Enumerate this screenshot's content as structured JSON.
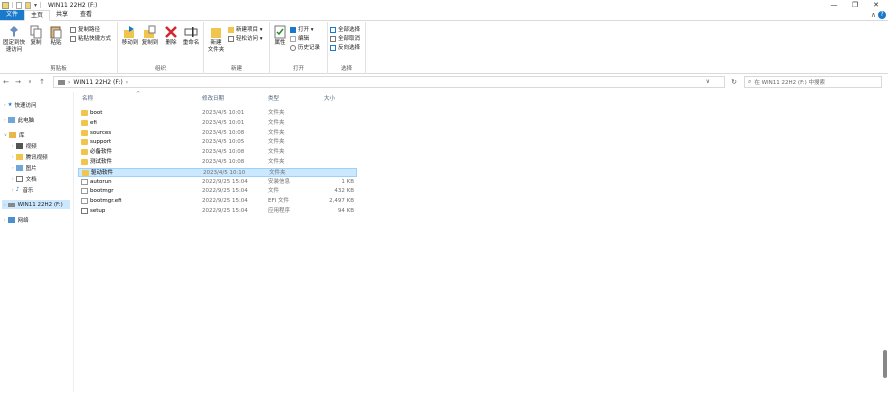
{
  "window": {
    "title": "WIN11 22H2 (F:)",
    "minimize": "—",
    "maximize": "❐",
    "close": "✕"
  },
  "ribbon_tabs": [
    "文件",
    "主页",
    "共享",
    "查看"
  ],
  "ribbon": {
    "clipboard": {
      "label": "剪贴板",
      "pin": "固定到快速访问",
      "copy": "复制",
      "paste": "粘贴",
      "copy_path": "复制路径",
      "paste_shortcut": "粘贴快捷方式"
    },
    "organize": {
      "label": "组织",
      "move_to": "移动到",
      "copy_to": "复制到",
      "delete": "删除",
      "rename": "重命名"
    },
    "new": {
      "label": "新建",
      "new_folder": "新建\n文件夹",
      "new_item": "新建项目 ▾",
      "easy_access": "轻松访问 ▾"
    },
    "open": {
      "label": "打开",
      "properties": "属性",
      "open": "打开 ▾",
      "edit": "编辑",
      "history": "历史记录"
    },
    "select": {
      "label": "选择",
      "select_all": "全部选择",
      "select_none": "全部取消",
      "invert": "反向选择"
    }
  },
  "address": {
    "path": "WIN11 22H2 (F:)",
    "search_placeholder": "在 WIN11 22H2 (F:) 中搜索"
  },
  "nav": {
    "back": "←",
    "forward": "→",
    "recent": "∨",
    "up": "↑",
    "refresh": "↻"
  },
  "navpane": [
    {
      "label": "快速访问",
      "icon": "star-icon"
    },
    {
      "label": "此电脑",
      "icon": "computer-icon"
    },
    {
      "label": "库",
      "icon": "library-icon"
    },
    {
      "label": "视频",
      "icon": "video-icon"
    },
    {
      "label": "腾讯视频",
      "icon": "folder-icon"
    },
    {
      "label": "图片",
      "icon": "picture-icon"
    },
    {
      "label": "文档",
      "icon": "document-icon"
    },
    {
      "label": "音乐",
      "icon": "music-icon"
    },
    {
      "label": "WIN11 22H2 (F:)",
      "icon": "drive-icon"
    },
    {
      "label": "网络",
      "icon": "network-icon"
    }
  ],
  "columns": {
    "name": "名称",
    "date": "修改日期",
    "type": "类型",
    "size": "大小"
  },
  "files": [
    {
      "name": "boot",
      "date": "2023/4/5 10:01",
      "type": "文件夹",
      "size": "",
      "kind": "folder"
    },
    {
      "name": "efi",
      "date": "2023/4/5 10:01",
      "type": "文件夹",
      "size": "",
      "kind": "folder"
    },
    {
      "name": "sources",
      "date": "2023/4/5 10:08",
      "type": "文件夹",
      "size": "",
      "kind": "folder"
    },
    {
      "name": "support",
      "date": "2023/4/5 10:05",
      "type": "文件夹",
      "size": "",
      "kind": "folder"
    },
    {
      "name": "必备软件",
      "date": "2023/4/5 10:08",
      "type": "文件夹",
      "size": "",
      "kind": "folder"
    },
    {
      "name": "测试软件",
      "date": "2023/4/5 10:08",
      "type": "文件夹",
      "size": "",
      "kind": "folder"
    },
    {
      "name": "驱动软件",
      "date": "2023/4/5 10:10",
      "type": "文件夹",
      "size": "",
      "kind": "folder"
    },
    {
      "name": "autorun",
      "date": "2022/9/25 15:04",
      "type": "安装信息",
      "size": "1 KB",
      "kind": "doc"
    },
    {
      "name": "bootmgr",
      "date": "2022/9/25 15:04",
      "type": "文件",
      "size": "432 KB",
      "kind": "doc"
    },
    {
      "name": "bootmgr.efi",
      "date": "2022/9/25 15:04",
      "type": "EFI 文件",
      "size": "2,497 KB",
      "kind": "doc"
    },
    {
      "name": "setup",
      "date": "2022/9/25 15:04",
      "type": "应用程序",
      "size": "94 KB",
      "kind": "exe"
    }
  ]
}
